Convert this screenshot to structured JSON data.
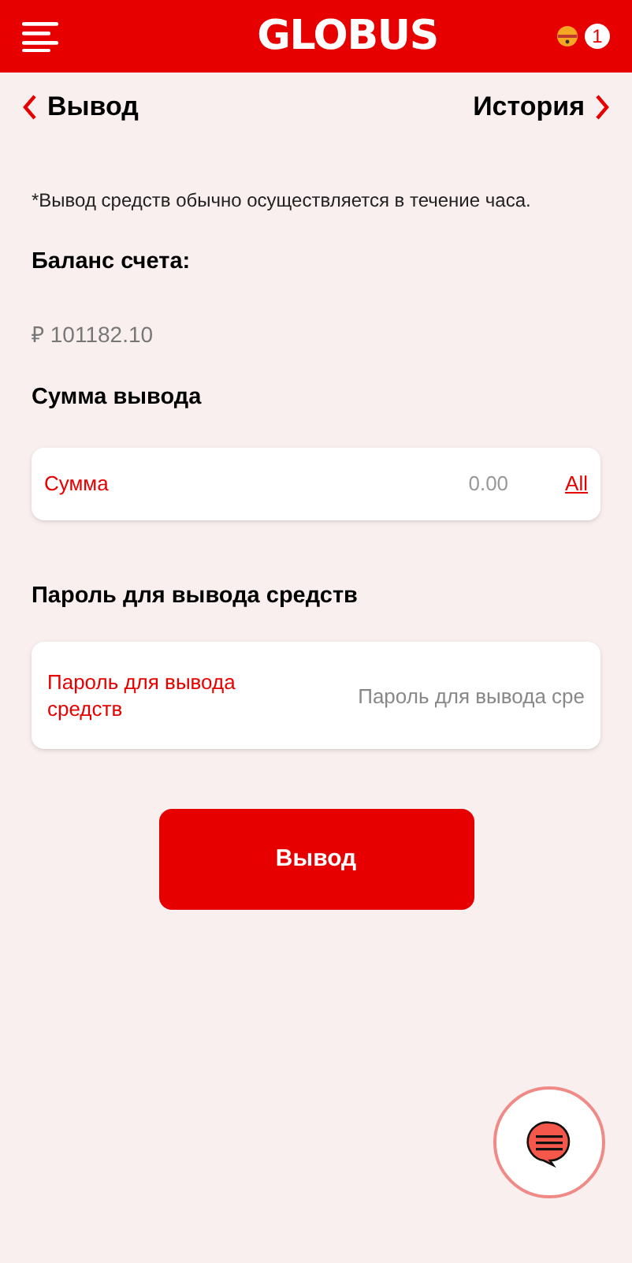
{
  "header": {
    "logo": "GLOBUS",
    "notification_count": "1"
  },
  "nav": {
    "back_label": "Вывод",
    "history_label": "История"
  },
  "notice": "*Вывод средств обычно осуществляется в течение часа.",
  "balance": {
    "label": "Баланс счета:",
    "value": "₽ 101182.10"
  },
  "amount": {
    "label": "Сумма вывода",
    "field_label": "Сумма",
    "placeholder": "0.00",
    "all_link": "All"
  },
  "password": {
    "label": "Пароль для вывода средств",
    "field_label": "Пароль для вывода средств",
    "placeholder": "Пароль для вывода сре"
  },
  "submit": {
    "label": "Вывод"
  }
}
